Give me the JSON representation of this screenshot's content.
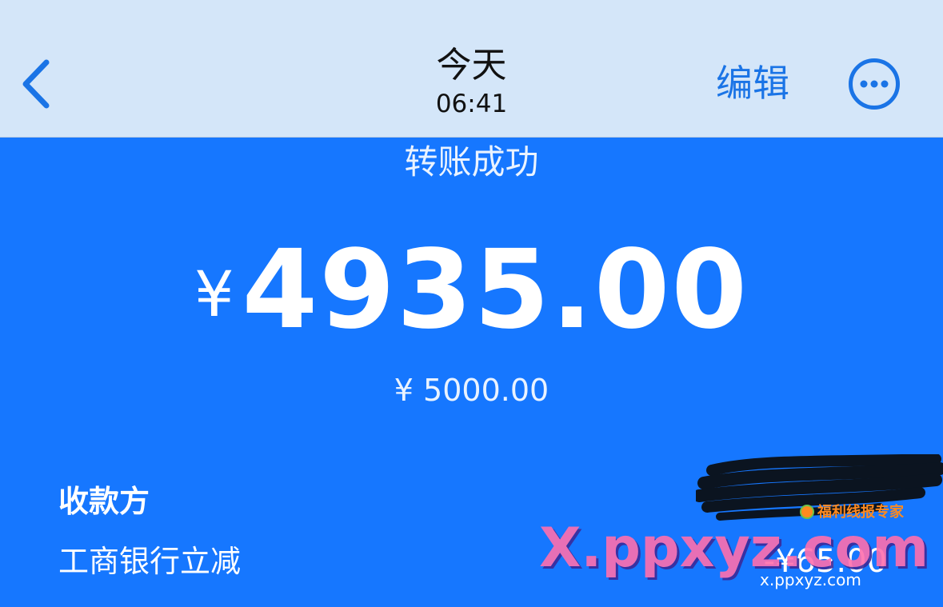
{
  "nav": {
    "back_icon": "chevron-left-icon",
    "title": "今天",
    "time": "06:41",
    "edit_label": "编辑",
    "more_icon": "ellipsis-circle-icon"
  },
  "transaction": {
    "status": "转账成功",
    "currency_symbol": "¥",
    "amount": "4935.00",
    "original_amount": "¥ 5000.00",
    "payee_label": "收款方",
    "discount_label": "工商银行立减",
    "discount_value": "-¥65.00"
  },
  "watermark": {
    "brand": "福利线报专家",
    "main": "X.ppxyz.com",
    "sub": "x.ppxyz.com"
  },
  "colors": {
    "nav_background": "#d4e6f9",
    "accent_blue": "#1a74e6",
    "body_background": "#1677ff",
    "text_white": "#ffffff"
  }
}
